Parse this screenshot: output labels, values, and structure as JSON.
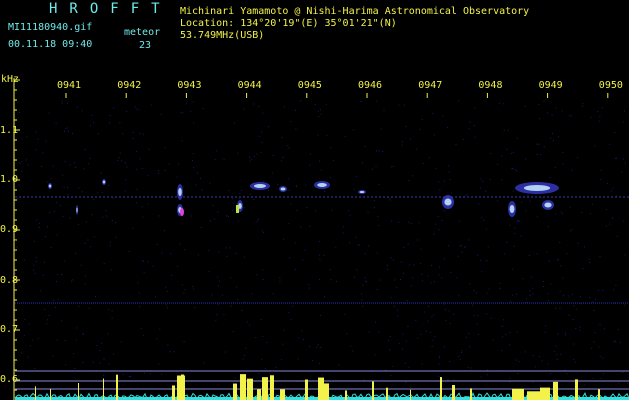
{
  "header": {
    "title": "HROFFT",
    "filename": "MI11180940.gif",
    "datetime": "00.11.18 09:40",
    "meteor_label": "meteor",
    "meteor_count": "23",
    "observer": "Michinari Yamamoto @ Nishi-Harima Astronomical Observatory",
    "location": "Location: 134°20'19\"(E) 35°01'21\"(N)",
    "frequency": "53.749MHz(USB)"
  },
  "axis": {
    "unit": "kHz",
    "time_ticks": [
      "0941",
      "0942",
      "0943",
      "0944",
      "0945",
      "0946",
      "0947",
      "0948",
      "0949",
      "0950"
    ],
    "freq_ticks": [
      "1.1",
      "1.0",
      "0.9",
      "0.8",
      "0.7",
      "0.6"
    ]
  },
  "colors": {
    "header_text": "#6fe9e9",
    "axis_text": "#f2f24a",
    "background": "#000000",
    "reference_line": "#3030c0",
    "meteor_echo": "#c8f0ff",
    "spectrum": "#f2f24a",
    "noise_floor": "#33e0e0"
  }
}
